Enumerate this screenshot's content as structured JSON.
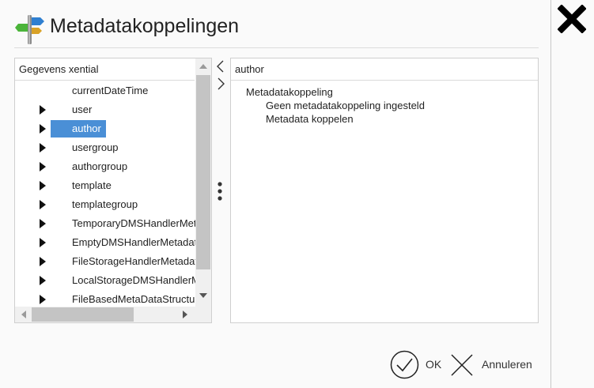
{
  "dialog": {
    "title": "Metadatakoppelingen",
    "icon": "signpost-icon"
  },
  "left_panel": {
    "header": "Gegevens xential",
    "items": [
      {
        "label": "currentDateTime",
        "expandable": false,
        "selected": false
      },
      {
        "label": "user",
        "expandable": true,
        "selected": false
      },
      {
        "label": "author",
        "expandable": true,
        "selected": true
      },
      {
        "label": "usergroup",
        "expandable": true,
        "selected": false
      },
      {
        "label": "authorgroup",
        "expandable": true,
        "selected": false
      },
      {
        "label": "template",
        "expandable": true,
        "selected": false
      },
      {
        "label": "templategroup",
        "expandable": true,
        "selected": false
      },
      {
        "label": "TemporaryDMSHandlerMet",
        "expandable": true,
        "selected": false
      },
      {
        "label": "EmptyDMSHandlerMetadat",
        "expandable": true,
        "selected": false
      },
      {
        "label": "FileStorageHandlerMetadat",
        "expandable": true,
        "selected": false
      },
      {
        "label": "LocalStorageDMSHandlerM",
        "expandable": true,
        "selected": false
      },
      {
        "label": "FileBasedMetaDataStructur",
        "expandable": true,
        "selected": false
      }
    ]
  },
  "navigation": {
    "prev_icon": "chevron-left-icon",
    "next_icon": "chevron-right-icon",
    "handle_icon": "vertical-dots-icon"
  },
  "right_panel": {
    "header": "author",
    "mapping_label": "Metadatakoppeling",
    "no_mapping_text": "Geen metadatakoppeling ingesteld",
    "link_text": "Metadata koppelen"
  },
  "buttons": {
    "ok": "OK",
    "cancel": "Annuleren"
  },
  "colors": {
    "selection": "#4a8fd6",
    "background": "#fafafa"
  }
}
